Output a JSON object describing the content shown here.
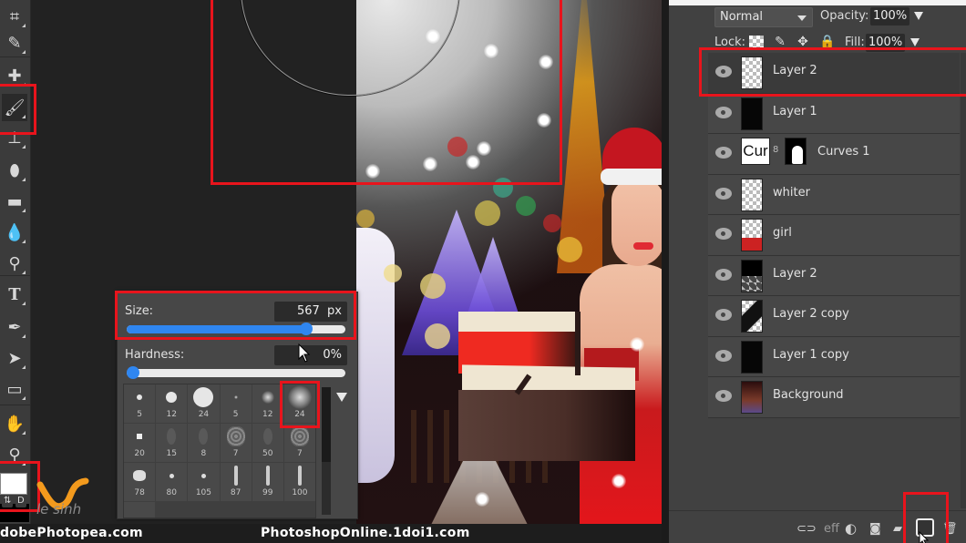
{
  "toolbar": {
    "tools": [
      {
        "name": "crop",
        "glyph": "⌗"
      },
      {
        "name": "eyedropper",
        "glyph": "✎"
      },
      {
        "name": "healing",
        "glyph": "✚"
      },
      {
        "name": "brush",
        "glyph": "🖌",
        "active": true
      },
      {
        "name": "clone-stamp",
        "glyph": "⊥"
      },
      {
        "name": "eraser",
        "glyph": "⬮"
      },
      {
        "name": "gradient",
        "glyph": "▬"
      },
      {
        "name": "blur",
        "glyph": "💧"
      },
      {
        "name": "dodge",
        "glyph": "⚲"
      },
      {
        "name": "type",
        "glyph": "T"
      },
      {
        "name": "pen",
        "glyph": "✒"
      },
      {
        "name": "path-select",
        "glyph": "➤"
      },
      {
        "name": "shape",
        "glyph": "▭"
      },
      {
        "name": "hand",
        "glyph": "✋"
      },
      {
        "name": "zoom",
        "glyph": "⚲"
      }
    ],
    "swap_label": "⇅",
    "default_label": "D"
  },
  "brush_panel": {
    "size_label": "Size:",
    "size_value": "567",
    "size_unit": "px",
    "size_fraction": 0.82,
    "hardness_label": "Hardness:",
    "hardness_value": "0%",
    "hardness_fraction": 0.0,
    "presets": [
      {
        "size": "5",
        "kind": "hard"
      },
      {
        "size": "12",
        "kind": "hard"
      },
      {
        "size": "24",
        "kind": "hard"
      },
      {
        "size": "5",
        "kind": "soft"
      },
      {
        "size": "12",
        "kind": "soft"
      },
      {
        "size": "24",
        "kind": "soft",
        "selected": true
      },
      {
        "size": "20",
        "kind": "square"
      },
      {
        "size": "15",
        "kind": "faint"
      },
      {
        "size": "8",
        "kind": "faint"
      },
      {
        "size": "7",
        "kind": "texture"
      },
      {
        "size": "50",
        "kind": "faint"
      },
      {
        "size": "7",
        "kind": "texture"
      },
      {
        "size": "78",
        "kind": "blob"
      },
      {
        "size": "80",
        "kind": "dot"
      },
      {
        "size": "105",
        "kind": "dot"
      },
      {
        "size": "87",
        "kind": "stroke"
      },
      {
        "size": "99",
        "kind": "stroke"
      },
      {
        "size": "100",
        "kind": "stroke"
      }
    ]
  },
  "layers_panel": {
    "blend_mode": "Normal",
    "opacity_label": "Opacity:",
    "opacity_value": "100%",
    "lock_label": "Lock:",
    "fill_label": "Fill:",
    "fill_value": "100%",
    "layers": [
      {
        "name": "Layer 2",
        "thumb": "checker",
        "selected": true
      },
      {
        "name": "Layer 1",
        "thumb": "dark"
      },
      {
        "name": "Curves 1",
        "thumb": "curves"
      },
      {
        "name": "whiter",
        "thumb": "checker"
      },
      {
        "name": "girl",
        "thumb": "girl"
      },
      {
        "name": "Layer 2",
        "thumb": "half"
      },
      {
        "name": "Layer 2 copy",
        "thumb": "copy"
      },
      {
        "name": "Layer 1 copy",
        "thumb": "dark"
      },
      {
        "name": "Background",
        "thumb": "photo"
      }
    ],
    "curves_thumb_text": "Cur",
    "footer": {
      "link": "link-icon",
      "effects_label": "eff",
      "adjustment": "adjustment-icon",
      "mask": "mask-icon",
      "folder": "folder-icon",
      "new_layer": "new-layer-icon",
      "delete": "trash-icon"
    }
  },
  "watermark": {
    "logo_text": "le sinh",
    "left_url": "dobePhotopea.com",
    "right_url": "PhotoshopOnline.1doi1.com"
  },
  "colors": {
    "annotation_red": "#e8141c",
    "slider_blue": "#2f86f0",
    "logo_orange": "#f39a1d"
  }
}
